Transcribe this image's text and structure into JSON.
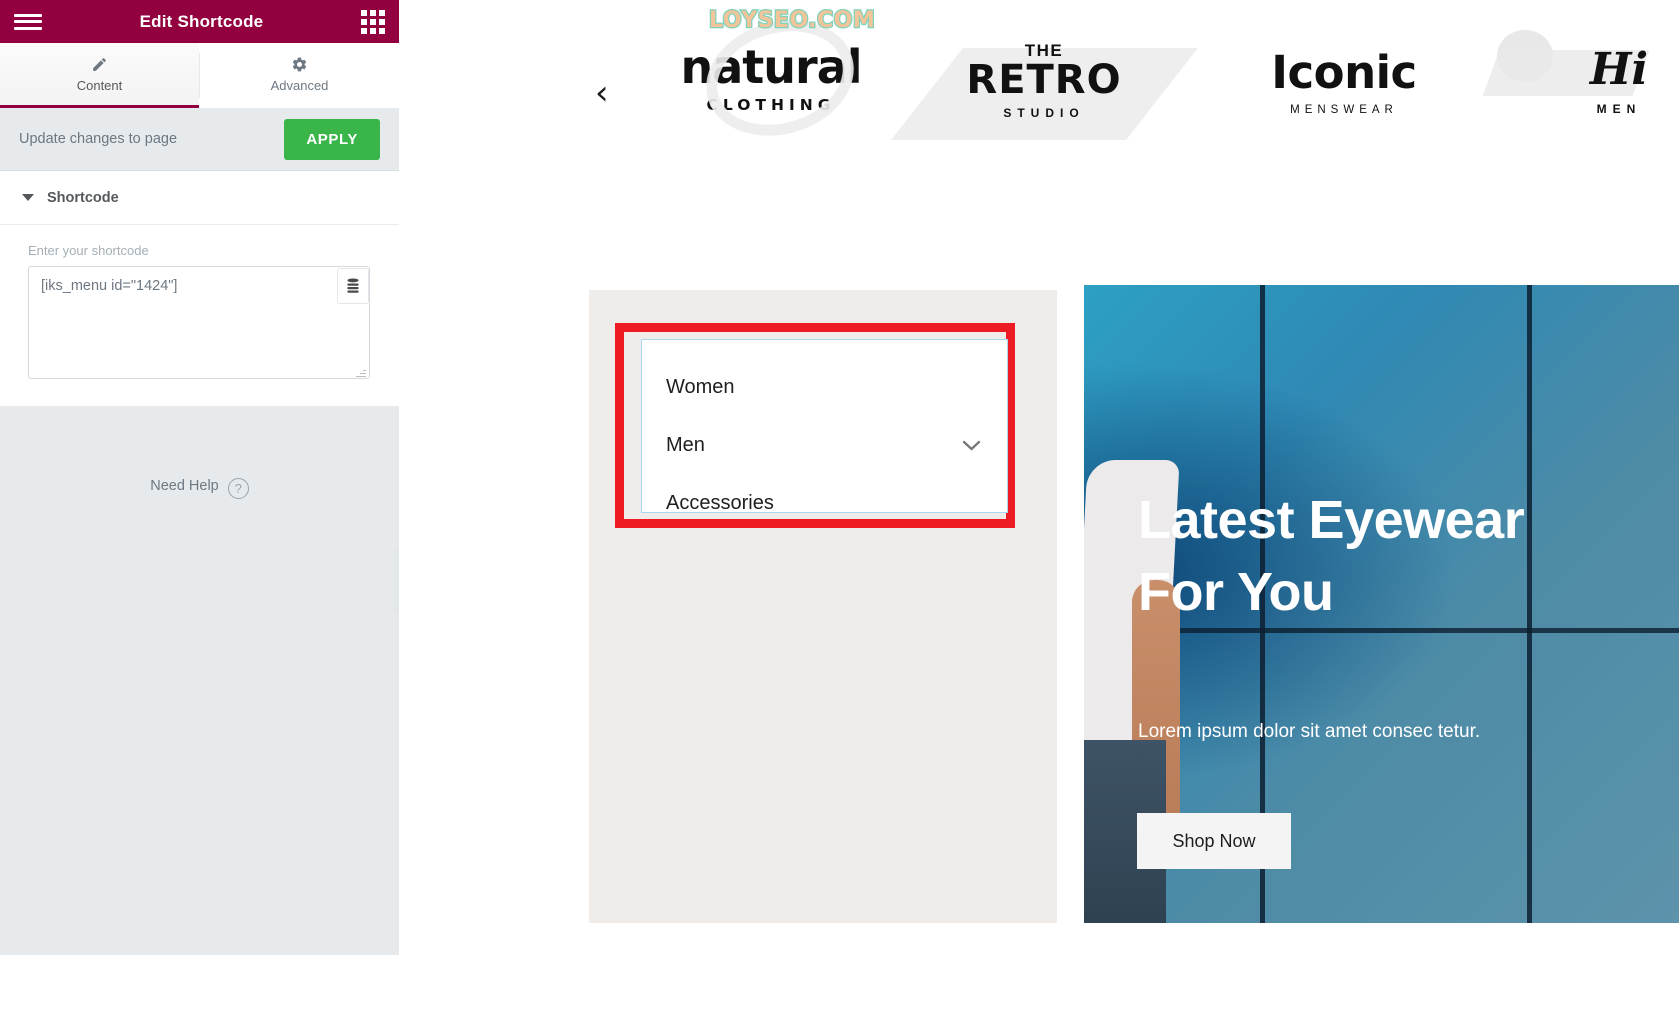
{
  "editor": {
    "header": {
      "title": "Edit Shortcode",
      "menu_icon": "hamburger-menu-icon",
      "grid_icon": "apps-grid-icon"
    },
    "tabs": [
      {
        "label": "Content",
        "icon": "pencil-icon",
        "active": true
      },
      {
        "label": "Advanced",
        "icon": "gear-icon",
        "active": false
      }
    ],
    "apply_row": {
      "text": "Update changes to page",
      "button_label": "APPLY"
    },
    "section": {
      "title": "Shortcode",
      "caret_icon": "caret-down-icon"
    },
    "shortcode_field": {
      "label": "Enter your shortcode",
      "value": "[iks_menu id=\"1424\"]",
      "db_icon": "database-icon"
    },
    "need_help": {
      "text": "Need Help",
      "icon": "question-circle-icon"
    },
    "collapse_handle_icon": "chevron-left-icon"
  },
  "preview": {
    "watermark": "LOYSEO.COM",
    "carousel": {
      "prev_icon": "chevron-left-icon",
      "logos": [
        {
          "name": "natural",
          "sub": "CLOTHING"
        },
        {
          "the": "THE",
          "name": "RETRO",
          "sub": "STUDIO"
        },
        {
          "name": "Iconic",
          "sub": "MENSWEAR"
        },
        {
          "name": "Hi",
          "sub": "MEN"
        }
      ]
    },
    "menu": {
      "items": [
        {
          "label": "Women",
          "has_chevron": false
        },
        {
          "label": "Men",
          "has_chevron": true
        },
        {
          "label": "Accessories",
          "has_chevron": false
        }
      ],
      "chevron_icon": "chevron-down-icon"
    },
    "hero": {
      "title": "Latest Eyewear For You",
      "subtitle": "Lorem ipsum dolor sit amet consec tetur.",
      "button_label": "Shop Now"
    }
  },
  "colors": {
    "brand": "#93003f",
    "apply_green": "#39b54a",
    "annotation_red": "#ed1c24",
    "menu_border_blue": "#a8d7ef",
    "panel_bg": "#e6eaec",
    "card_bg": "#efecea"
  }
}
